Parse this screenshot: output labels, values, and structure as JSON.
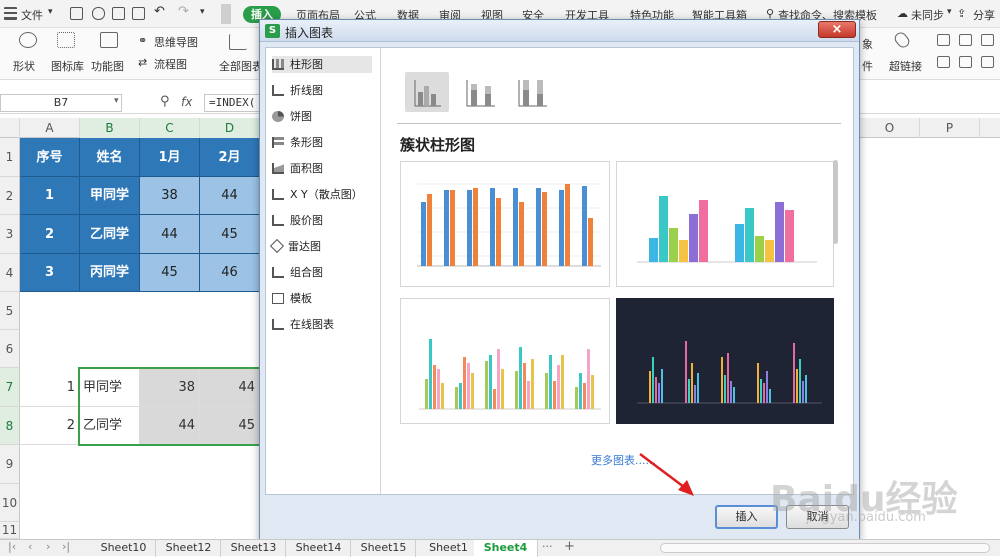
{
  "menubar": {
    "file": "文件",
    "tabs": [
      "插入",
      "页面布局",
      "公式",
      "数据",
      "审阅",
      "视图",
      "安全",
      "开发工具",
      "特色功能",
      "智能工具箱"
    ],
    "search": "查找命令、搜索模板",
    "sync": "未同步",
    "share": "分享"
  },
  "ribbon": {
    "items": [
      "形状",
      "图标库",
      "功能图",
      "思维导图",
      "流程图",
      "全部图表"
    ],
    "right_items": [
      "超链接",
      "象",
      "件"
    ]
  },
  "formula_bar": {
    "cell_ref": "B7",
    "fx": "fx",
    "formula": "=INDEX("
  },
  "columns": [
    "A",
    "B",
    "C",
    "D",
    "O",
    "P"
  ],
  "rows": [
    "1",
    "2",
    "3",
    "4",
    "5",
    "6",
    "7",
    "8",
    "9",
    "10",
    "11"
  ],
  "table": {
    "headers": [
      "序号",
      "姓名",
      "1月",
      "2月"
    ],
    "rows": [
      [
        "1",
        "甲同学",
        "38",
        "44"
      ],
      [
        "2",
        "乙同学",
        "44",
        "45"
      ],
      [
        "3",
        "丙同学",
        "45",
        "46"
      ]
    ]
  },
  "result": {
    "rows": [
      [
        "1",
        "甲同学",
        "38",
        "44"
      ],
      [
        "2",
        "乙同学",
        "44",
        "45"
      ]
    ]
  },
  "dialog": {
    "title": "插入图表",
    "categories": [
      "柱形图",
      "折线图",
      "饼图",
      "条形图",
      "面积图",
      "X Y（散点图）",
      "股价图",
      "雷达图",
      "组合图",
      "模板",
      "在线图表"
    ],
    "chart_title": "簇状柱形图",
    "more_charts": "更多图表......",
    "insert_button": "插入",
    "cancel_button": "取消"
  },
  "sheets": [
    "Sheet10",
    "Sheet12",
    "Sheet13",
    "Sheet14",
    "Sheet15",
    "Sheet1",
    "Sheet4"
  ],
  "watermark": "Baidu经验",
  "watermark_url": "jingyan.baidu.com"
}
